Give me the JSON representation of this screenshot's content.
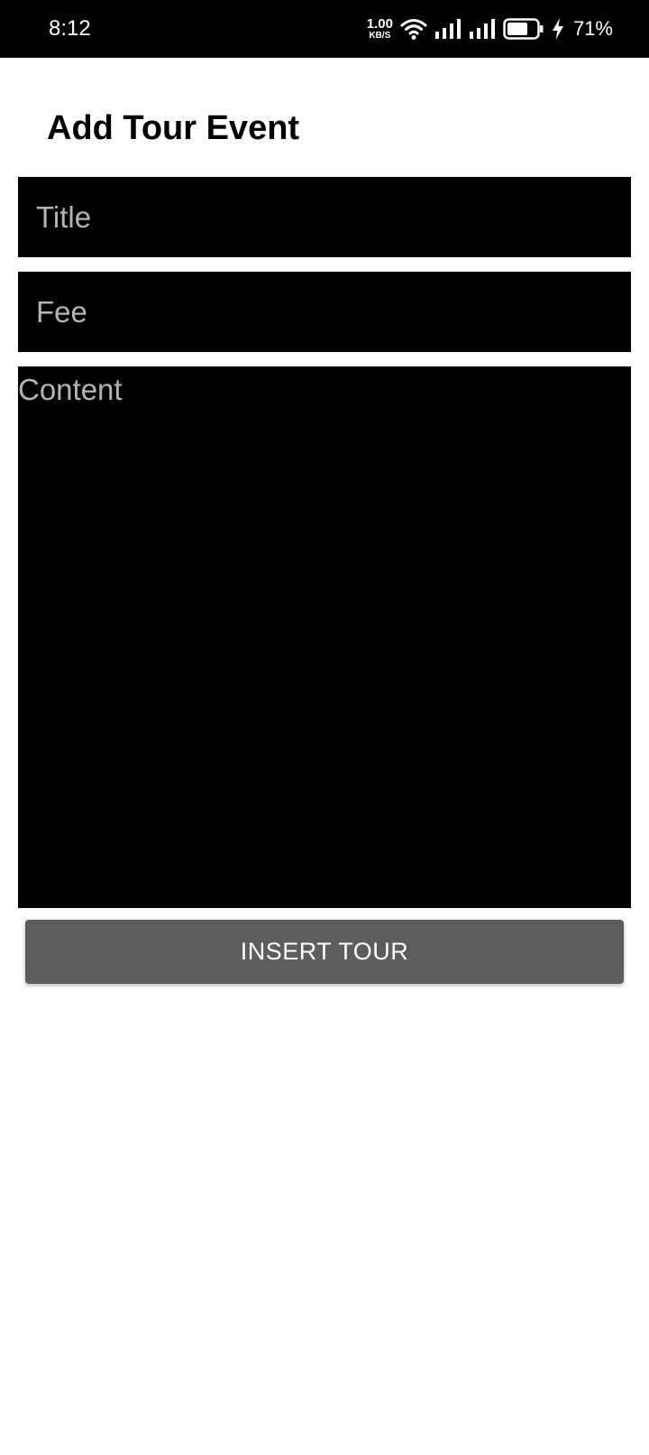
{
  "status_bar": {
    "time": "8:12",
    "net_speed_value": "1.00",
    "net_speed_unit": "KB/S",
    "battery_percent": "71%",
    "icons": [
      "wifi-icon",
      "signal-icon",
      "signal-icon",
      "battery-icon",
      "charging-icon"
    ]
  },
  "page": {
    "title": "Add Tour Event"
  },
  "form": {
    "title_field": {
      "value": "",
      "placeholder": "Title"
    },
    "fee_field": {
      "value": "",
      "placeholder": "Fee"
    },
    "content_field": {
      "value": "",
      "placeholder": "Content"
    },
    "submit_label": "INSERT TOUR"
  },
  "colors": {
    "status_bar_bg": "#000000",
    "field_bg": "#000000",
    "placeholder": "#b3b3b3",
    "button_bg": "#5d5d5e",
    "button_text": "#ffffff",
    "page_bg": "#ffffff"
  }
}
